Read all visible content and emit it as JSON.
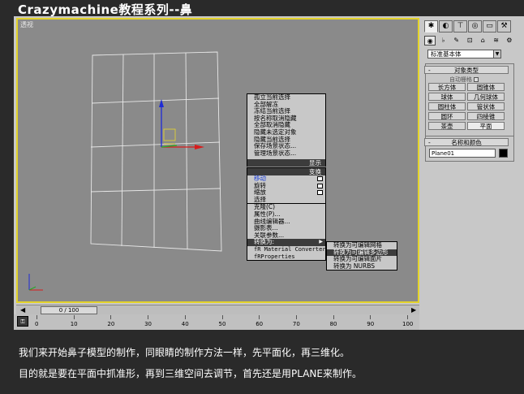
{
  "title": "Crazymachine教程系列--鼻",
  "viewport": {
    "label": "透视"
  },
  "quad_menu": {
    "display_items": [
      "孤立当前选择",
      "全部解冻",
      "冻结当前选择",
      "按名称取消隐藏",
      "全部取消隐藏",
      "隐藏未选定对象",
      "隐藏当前选择",
      "保存场景状态...",
      "管理场景状态..."
    ],
    "display_header": "显示",
    "transform_header": "变换",
    "transform_items": [
      "移动",
      "旋转",
      "缩放",
      "选择",
      "克隆(C)",
      "属性(P)...",
      "曲线编辑器...",
      "摄影表...",
      "关联参数...",
      "转换为:",
      "fR Material Converter",
      "fRProperties"
    ],
    "convert_submenu": [
      "转换为可编辑网格",
      "转换为可编辑多边形",
      "转换为可编辑面片",
      "转换为 NURBS"
    ]
  },
  "timeline": {
    "slider_label": "0 / 100",
    "ticks": [
      "0",
      "10",
      "20",
      "30",
      "40",
      "50",
      "60",
      "70",
      "80",
      "90",
      "100"
    ]
  },
  "command_panel": {
    "tabs": [
      "create-icon",
      "modify-icon",
      "hierarchy-icon",
      "motion-icon",
      "display-icon",
      "utilities-icon"
    ],
    "category_icons": [
      "geometry-icon",
      "shapes-icon",
      "lights-icon",
      "cameras-icon",
      "helpers-icon",
      "spacewarps-icon",
      "systems-icon"
    ],
    "dropdown_value": "标准基本体",
    "object_type_header": "对象类型",
    "auto_grid_label": "自动栅格",
    "object_buttons": [
      "长方体",
      "圆锥体",
      "球体",
      "几何球体",
      "圆柱体",
      "管状体",
      "圆环",
      "四棱锥",
      "茶壶",
      "平面"
    ],
    "name_color_header": "名称和颜色",
    "object_name": "Plane01",
    "object_color": "#000000"
  },
  "caption": {
    "line1": "我们来开始鼻子模型的制作，同眼睛的制作方法一样，先平面化，再三维化。",
    "line2": "目的就是要在平面中抓准形，再到三维空间去调节，首先还是用PLANE来制作。"
  },
  "colors": {
    "viewport_border": "#e3d32a",
    "viewport_bg": "#8a8a8a",
    "ui_gray": "#c8c8c8",
    "highlight": "#3c3c3c"
  }
}
